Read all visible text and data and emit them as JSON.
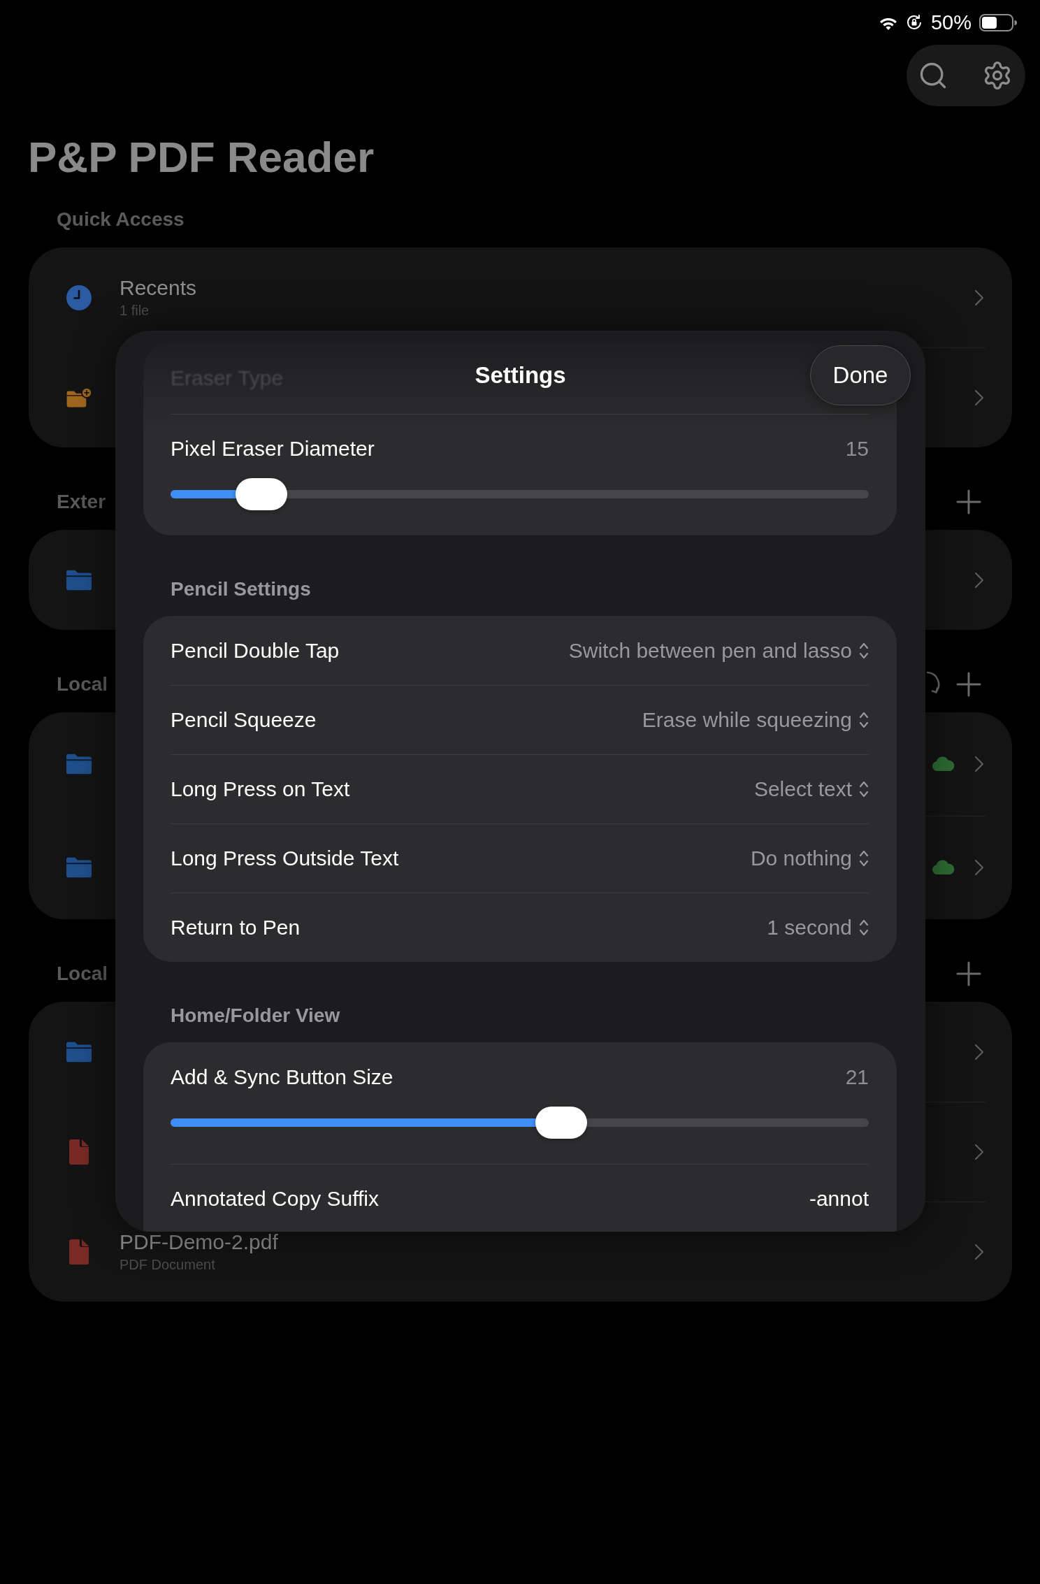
{
  "status_bar": {
    "battery_text": "50%"
  },
  "title": "P&P PDF Reader",
  "sections": [
    {
      "header": "Quick Access",
      "sync_button": false,
      "add_button": false,
      "rows": [
        {
          "kind": "recents",
          "title": "Recents",
          "subtitle": "1 file",
          "synced": false
        },
        {
          "kind": "folder-add",
          "synced": false
        }
      ]
    },
    {
      "header": "Exter",
      "sync_button": false,
      "add_button": true,
      "rows": [
        {
          "kind": "folder",
          "synced": false
        }
      ]
    },
    {
      "header": "Local",
      "sync_button": true,
      "add_button": true,
      "rows": [
        {
          "kind": "folder",
          "synced": true
        },
        {
          "kind": "folder",
          "synced": true
        }
      ]
    },
    {
      "header": "Local",
      "sync_button": false,
      "add_button": true,
      "rows": [
        {
          "kind": "folder",
          "synced": false
        },
        {
          "kind": "pdf",
          "synced": false
        },
        {
          "kind": "pdf",
          "title": "PDF-Demo-2.pdf",
          "subtitle": "PDF Document",
          "synced": false
        }
      ]
    }
  ],
  "settings_sheet": {
    "title": "Settings",
    "done_button": "Done",
    "groups": [
      {
        "rows": [
          {
            "kind": "faded",
            "label": "Eraser Type"
          },
          {
            "kind": "slider",
            "label": "Pixel Eraser Diameter",
            "reading": "15",
            "level": 0.13
          }
        ]
      },
      {
        "header": "Pencil Settings",
        "rows": [
          {
            "kind": "picker",
            "label": "Pencil Double Tap",
            "value": "Switch between pen and lasso"
          },
          {
            "kind": "picker",
            "label": "Pencil Squeeze",
            "value": "Erase while squeezing"
          },
          {
            "kind": "picker",
            "label": "Long Press on Text",
            "value": "Select text"
          },
          {
            "kind": "picker",
            "label": "Long Press Outside Text",
            "value": "Do nothing"
          },
          {
            "kind": "picker",
            "label": "Return to Pen",
            "value": "1 second"
          }
        ]
      },
      {
        "header": "Home/Folder View",
        "rows": [
          {
            "kind": "slider",
            "label": "Add & Sync Button Size",
            "reading": "21",
            "level": 0.56
          },
          {
            "kind": "text",
            "label": "Annotated Copy Suffix",
            "value": "-annot"
          }
        ]
      }
    ]
  }
}
